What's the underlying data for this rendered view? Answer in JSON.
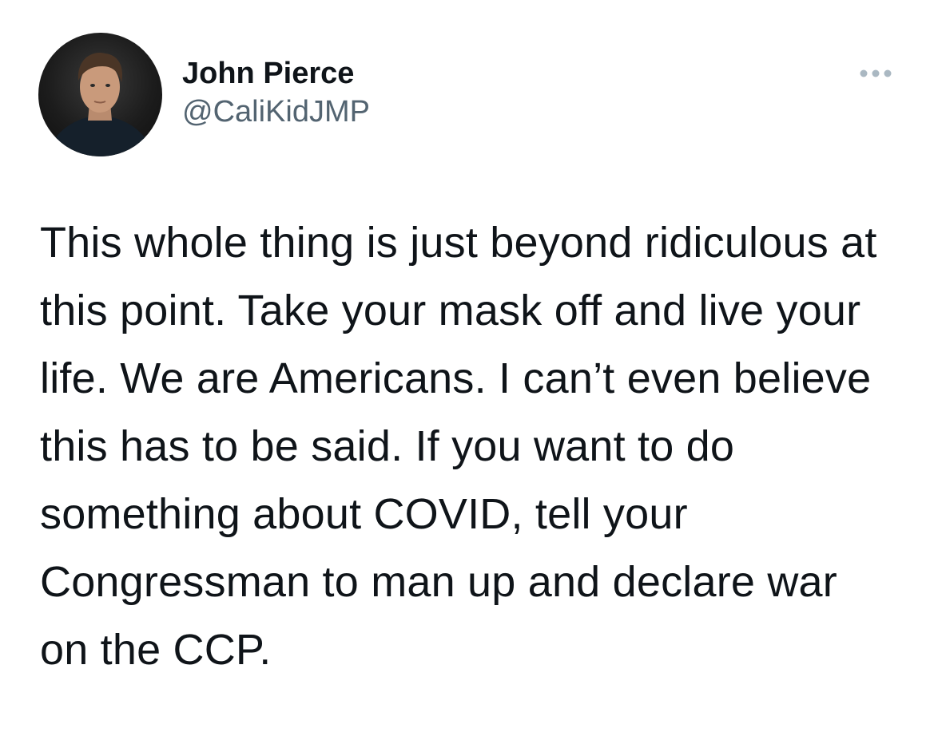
{
  "author": {
    "display_name": "John Pierce",
    "handle": "@CaliKidJMP"
  },
  "menu": {
    "icon": "more-horizontal-icon"
  },
  "tweet": {
    "text": "This whole thing is just beyond ridiculous at this point. Take your mask off and live your life. We are Americans. I can’t even believe this has to be said. If you want to do something about COVID, tell your Congressman to man up and declare war on the CCP."
  },
  "colors": {
    "text_primary": "#0f1419",
    "text_secondary": "#536471",
    "background": "#ffffff"
  }
}
